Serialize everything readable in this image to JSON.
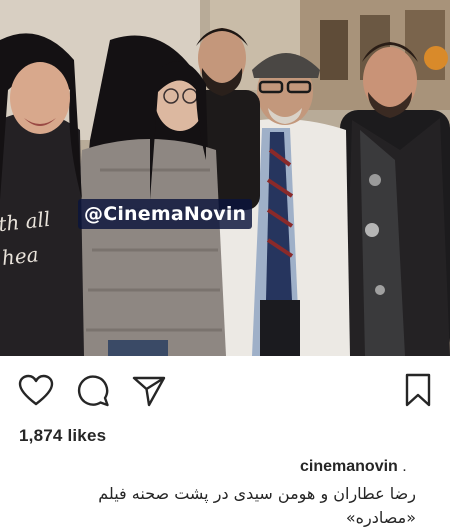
{
  "photo": {
    "watermark": "@CinemaNovin",
    "sweater_print": [
      "th all",
      "hea"
    ]
  },
  "actions": {
    "like_icon": "heart-outline-icon",
    "comment_icon": "speech-bubble-icon",
    "share_icon": "paper-plane-icon",
    "save_icon": "bookmark-icon"
  },
  "post": {
    "likes": "1,874 likes",
    "username": "cinemanovin",
    "username_suffix": " .",
    "caption_line1": "رضا عطاران و هومن سیدی در پشت صحنه فیلم",
    "caption_line2": "«مصادره»"
  },
  "colors": {
    "text": "#262626",
    "watermark_bg": "#0a143c",
    "background": "#ffffff"
  }
}
